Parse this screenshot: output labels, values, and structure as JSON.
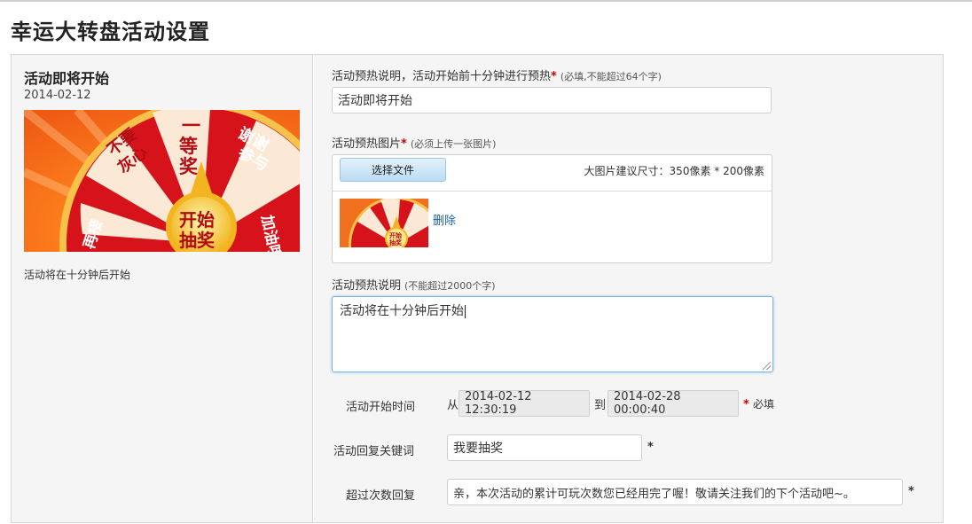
{
  "page": {
    "title": "幸运大转盘活动设置"
  },
  "preview": {
    "title": "活动即将开始",
    "date": "2014-02-12",
    "description": "活动将在十分钟后开始"
  },
  "wheel": {
    "segments": [
      "一等奖",
      "谢谢参与",
      "加油哦",
      "再接再厉",
      "不要灰心"
    ],
    "center": [
      "开始",
      "抽奖"
    ],
    "colors": {
      "red": "#d6121a",
      "dark_red": "#b10a10",
      "orange": "#ff6a18",
      "gold": "#f2b51f"
    }
  },
  "form": {
    "warmup_desc": {
      "label": "活动预热说明，活动开始前十分钟进行预热",
      "required_mark": "*",
      "hint": "(必填,不能超过64个字)",
      "value": "活动即将开始"
    },
    "warmup_image": {
      "label": "活动预热图片",
      "required_mark": "*",
      "hint": "(必须上传一张图片)",
      "choose_button": "选择文件",
      "size_hint": "大图片建议尺寸：350像素 * 200像素",
      "delete_link": "删除"
    },
    "warmup_text": {
      "label": "活动预热说明",
      "hint": "(不能超过2000个字)",
      "value": "活动将在十分钟后开始"
    },
    "start_time": {
      "label": "活动开始时间",
      "from_label": "从",
      "from_value": "2014-02-12 12:30:19",
      "to_label": "到",
      "to_value": "2014-02-28 00:00:40",
      "required_mark": "*",
      "required_text": "必填"
    },
    "keyword": {
      "label": "活动回复关键词",
      "value": "我要抽奖",
      "required_mark": "*"
    },
    "over_limit": {
      "label": "超过次数回复",
      "value": "亲，本次活动的累计可玩次数您已经用完了喔！敬请关注我们的下个活动吧~。",
      "required_mark": "*"
    }
  }
}
